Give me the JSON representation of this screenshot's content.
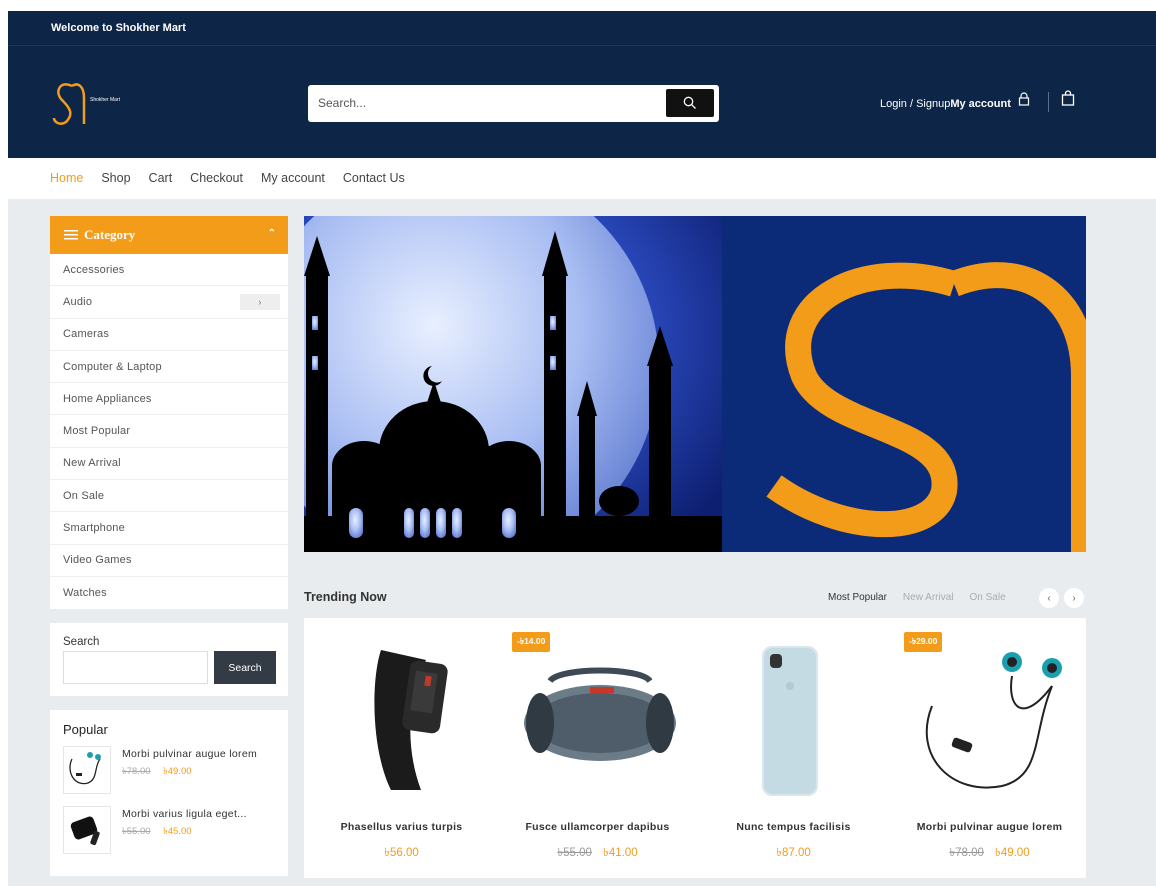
{
  "topbar": {
    "welcome": "Welcome to Shokher Mart"
  },
  "header": {
    "logo_text": "Shokher Mart",
    "search_placeholder": "Search...",
    "login_label": "Login / Signup",
    "account_label": "My account"
  },
  "nav": {
    "items": [
      "Home",
      "Shop",
      "Cart",
      "Checkout",
      "My account",
      "Contact Us"
    ],
    "active": "Home"
  },
  "category": {
    "title": "Category",
    "items": [
      "Accessories",
      "Audio",
      "Cameras",
      "Computer & Laptop",
      "Home Appliances",
      "Most Popular",
      "New Arrival",
      "On Sale",
      "Smartphone",
      "Video Games",
      "Watches"
    ]
  },
  "search_widget": {
    "title": "Search",
    "button": "Search"
  },
  "popular": {
    "title": "Popular",
    "items": [
      {
        "name": "Morbi pulvinar augue lorem",
        "old_price": "৳78.00",
        "new_price": "৳49.00"
      },
      {
        "name": "Morbi varius ligula eget...",
        "old_price": "৳55.00",
        "new_price": "৳45.00"
      }
    ]
  },
  "trending": {
    "title": "Trending Now",
    "tabs": [
      "Most Popular",
      "New Arrival",
      "On Sale"
    ],
    "active_tab": "Most Popular",
    "products": [
      {
        "name": "Phasellus varius turpis",
        "badge": "",
        "old_price": "",
        "new_price": "৳56.00"
      },
      {
        "name": "Fusce ullamcorper dapibus",
        "badge": "-৳14.00",
        "old_price": "৳55.00",
        "new_price": "৳41.00"
      },
      {
        "name": "Nunc tempus facilisis",
        "badge": "",
        "old_price": "",
        "new_price": "৳87.00"
      },
      {
        "name": "Morbi pulvinar augue lorem",
        "badge": "-৳29.00",
        "old_price": "৳78.00",
        "new_price": "৳49.00"
      }
    ]
  },
  "colors": {
    "navy": "#0d2547",
    "accent": "#f39c1a",
    "banner_blue": "#0b2a78"
  }
}
